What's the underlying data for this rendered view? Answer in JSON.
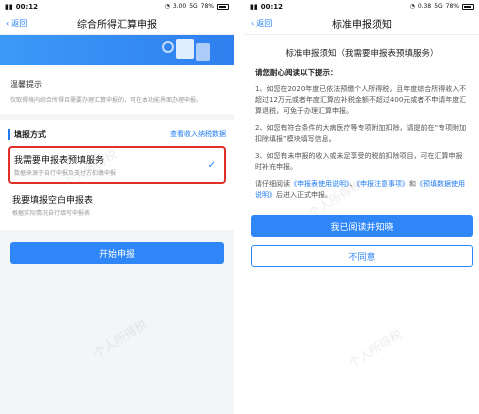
{
  "status_left": {
    "time": "00:12",
    "signal": "5G",
    "net_speed": "3.00",
    "battery": "78%"
  },
  "status_right": {
    "time": "00:12",
    "signal": "5G",
    "net_speed": "0.38",
    "battery": "78%"
  },
  "left": {
    "back": "返回",
    "title": "综合所得汇算申报",
    "tips_title": "温馨提示",
    "tips_text": "仅取得境内综合所得且需要办理汇算申报的，可在本功能界面办理申报。",
    "method_label": "填报方式",
    "view_income": "查看收入纳税数据",
    "option1_title": "我需要申报表预填服务",
    "option1_desc": "数据来源于自行申报及支付方扣缴申报",
    "option2_title": "我要填报空白申报表",
    "option2_desc": "根据实际情况自行填写申报表",
    "start_button": "开始申报"
  },
  "right": {
    "back": "返回",
    "title": "标准申报须知",
    "heading": "标准申报须知（我需要申报表预填服务）",
    "subheading": "请您耐心阅读以下提示：",
    "para1": "1、如您在2020年度已依法预缴个人所得税，且年度综合所得收入不超过12万元或者年度汇算应补税金额不超过400元或者不申请年度汇算退税，可免于办理汇算申报。",
    "para2": "2、如您有符合条件的大病医疗等专项附加扣除，请提前在“专项附加扣除填报”模块填写信息。",
    "para3": "3、如您有未申报的收入或未足享受的税前扣除项目，可在汇算申报时补充申报。",
    "para4_pre": "请仔细阅读",
    "link1": "《申报表使用说明》",
    "sep1": "、",
    "link2": "《申报注意事项》",
    "sep2": "和",
    "link3": "《预填数据使用说明》",
    "para4_post": "后进入正式申报。",
    "confirm_button": "我已阅读并知晓",
    "disagree_button": "不同意"
  },
  "watermark": "个人所得税"
}
